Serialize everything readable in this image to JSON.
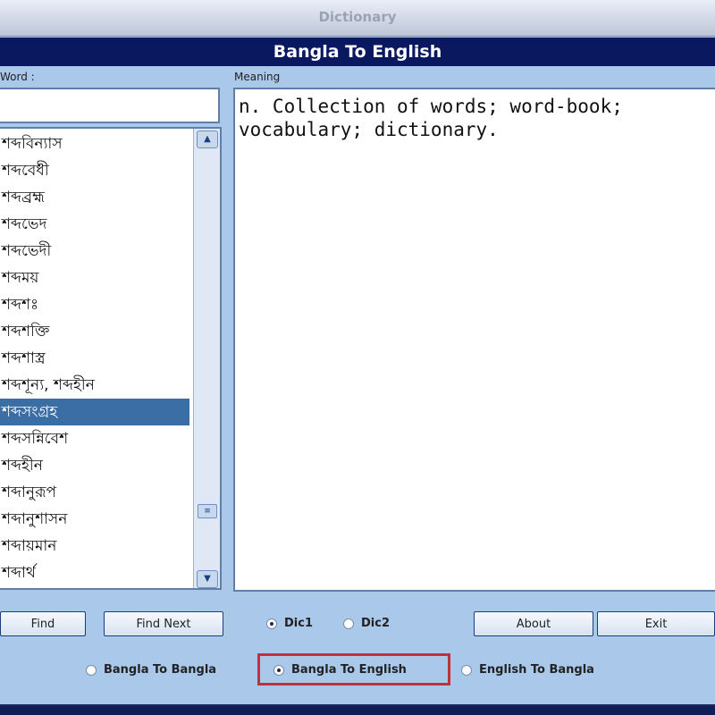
{
  "window": {
    "title": "Dictionary"
  },
  "header": {
    "mode_title": "Bangla To English"
  },
  "word_panel": {
    "label": "Word :",
    "input_value": "",
    "items": [
      "শব্দবিন্যাস",
      "শব্দবেধী",
      "শব্দব্রহ্ম",
      "শব্দভেদ",
      "শব্দভেদী",
      "শব্দময়",
      "শব্দশঃ",
      "শব্দশক্তি",
      "শব্দশাস্ত্র",
      "শব্দশূন্য, শব্দহীন",
      "শব্দসংগ্রহ",
      "শব্দসন্নিবেশ",
      "শব্দহীন",
      "শব্দানুরূপ",
      "শব্দানুশাসন",
      "শব্দায়মান",
      "শব্দার্থ"
    ],
    "selected_index": 10
  },
  "meaning_panel": {
    "label": "Meaning",
    "text": "n. Collection of words; word-book; vocabulary; dictionary."
  },
  "buttons": {
    "find": "Find",
    "find_next": "Find Next",
    "about": "About",
    "exit": "Exit"
  },
  "dictionary_choice": {
    "dic1": "Dic1",
    "dic2": "Dic2",
    "selected": "dic1"
  },
  "direction_choice": {
    "bangla_to_bangla": "Bangla To Bangla",
    "bangla_to_english": "Bangla To English",
    "english_to_bangla": "English To Bangla",
    "selected": "bangla_to_english"
  },
  "colors": {
    "accent_header": "#0a1860",
    "selection": "#3a6ea5",
    "highlight_outline": "#c0323a"
  }
}
